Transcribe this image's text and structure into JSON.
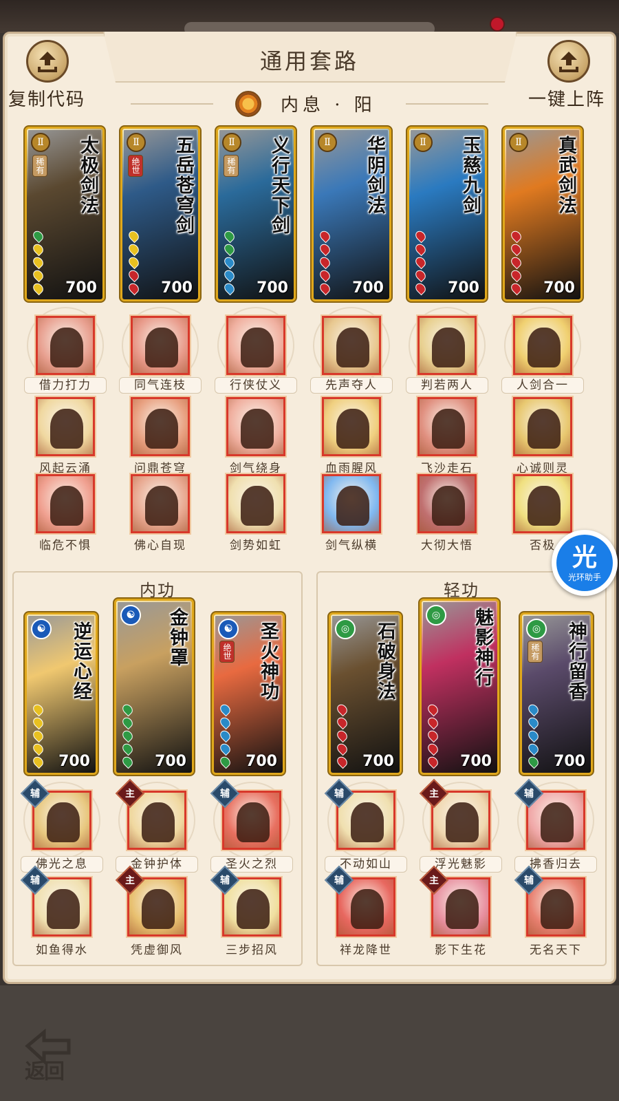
{
  "header": {
    "title": "通用套路",
    "left_label": "复制代码",
    "right_label": "一键上阵",
    "subtitle": "内息 · 阳"
  },
  "top_cards": [
    {
      "name": "太极剑法",
      "tier": "Ⅱ",
      "rarity": "稀有",
      "power": "700",
      "color": "#5a4830",
      "pips": [
        "#2e9a44",
        "#e8c020",
        "#e8c020",
        "#e8c020",
        "#e8c020"
      ]
    },
    {
      "name": "五岳苍穹剑",
      "tier": "Ⅱ",
      "rarity": "绝世",
      "power": "700",
      "color": "#2e5a88",
      "pips": [
        "#e8c020",
        "#e8c020",
        "#e8c020",
        "#c8262a",
        "#c8262a"
      ]
    },
    {
      "name": "义行天下剑",
      "tier": "Ⅱ",
      "rarity": "稀有",
      "power": "700",
      "color": "#2a6a9a",
      "pips": [
        "#2e9a44",
        "#2e9a44",
        "#2a8ac8",
        "#2a8ac8",
        "#2a8ac8"
      ]
    },
    {
      "name": "华阴剑法",
      "tier": "Ⅱ",
      "rarity": "",
      "power": "700",
      "color": "#3a78b8",
      "pips": [
        "#c8262a",
        "#c8262a",
        "#c8262a",
        "#c8262a",
        "#c8262a"
      ]
    },
    {
      "name": "玉慈九剑",
      "tier": "Ⅱ",
      "rarity": "",
      "power": "700",
      "color": "#2a7ac0",
      "pips": [
        "#c8262a",
        "#c8262a",
        "#c8262a",
        "#c8262a",
        "#c8262a"
      ]
    },
    {
      "name": "真武剑法",
      "tier": "Ⅱ",
      "rarity": "",
      "power": "700",
      "color": "#e07a20",
      "pips": [
        "#c8262a",
        "#c8262a",
        "#c8262a",
        "#c8262a",
        "#c8262a"
      ]
    }
  ],
  "skills_row1": [
    {
      "label": "借力打力",
      "color": "#e8a090"
    },
    {
      "label": "同气连枝",
      "color": "#e89a8a"
    },
    {
      "label": "行侠仗义",
      "color": "#f0b0a0"
    },
    {
      "label": "先声夺人",
      "color": "#e8c890"
    },
    {
      "label": "判若两人",
      "color": "#e8d090"
    },
    {
      "label": "人剑合一",
      "color": "#f0d070"
    }
  ],
  "skills_row2": [
    {
      "label": "风起云涌",
      "color": "#f0d8a0"
    },
    {
      "label": "问鼎苍穹",
      "color": "#e8a080"
    },
    {
      "label": "剑气绕身",
      "color": "#f0b0a0"
    },
    {
      "label": "血雨腥风",
      "color": "#f0d080"
    },
    {
      "label": "飞沙走石",
      "color": "#e09080"
    },
    {
      "label": "心诚则灵",
      "color": "#e8c870"
    }
  ],
  "skills_row3": [
    {
      "label": "临危不惧",
      "color": "#f0a090"
    },
    {
      "label": "佛心自现",
      "color": "#e8a890"
    },
    {
      "label": "剑势如虹",
      "color": "#f0e0b0"
    },
    {
      "label": "剑气纵横",
      "color": "#80b8f0"
    },
    {
      "label": "大彻大悟",
      "color": "#c07070"
    },
    {
      "label": "否极",
      "color": "#f0e080"
    }
  ],
  "neigong": {
    "title": "内功",
    "cards": [
      {
        "name": "逆运心经",
        "rarity": "",
        "power": "700",
        "color": "#f0c870",
        "pips": [
          "#e8c020",
          "#e8c020",
          "#e8c020",
          "#e8c020",
          "#e8c020"
        ]
      },
      {
        "name": "金钟罩",
        "rarity": "",
        "power": "700",
        "color": "#c8a060",
        "pips": [
          "#2e9a44",
          "#2e9a44",
          "#2e9a44",
          "#2e9a44",
          "#2e9a44"
        ]
      },
      {
        "name": "圣火神功",
        "rarity": "绝世",
        "power": "700",
        "color": "#e86a40",
        "pips": [
          "#2a8ac8",
          "#2a8ac8",
          "#2a8ac8",
          "#2a8ac8",
          "#2e9a44"
        ]
      }
    ],
    "skills1": [
      {
        "label": "佛光之息",
        "tag": "辅",
        "color": "#e8c880"
      },
      {
        "label": "金钟护体",
        "tag": "主",
        "color": "#f0d8a0"
      },
      {
        "label": "圣火之烈",
        "tag": "辅",
        "color": "#e87060"
      }
    ],
    "skills2": [
      {
        "label": "如鱼得水",
        "tag": "辅",
        "color": "#f0e0b0"
      },
      {
        "label": "凭虚御风",
        "tag": "主",
        "color": "#e8c070"
      },
      {
        "label": "三步招风",
        "tag": "辅",
        "color": "#f0e0a0"
      }
    ]
  },
  "qinggong": {
    "title": "轻功",
    "cards": [
      {
        "name": "石破身法",
        "rarity": "",
        "power": "700",
        "color": "#6a5030",
        "pips": [
          "#c8262a",
          "#c8262a",
          "#c8262a",
          "#c8262a",
          "#c8262a"
        ]
      },
      {
        "name": "魅影神行",
        "rarity": "",
        "power": "700",
        "color": "#c03060",
        "pips": [
          "#c8262a",
          "#c8262a",
          "#c8262a",
          "#c8262a",
          "#c8262a"
        ]
      },
      {
        "name": "神行留香",
        "rarity": "稀有",
        "power": "700",
        "color": "#5a4a6a",
        "pips": [
          "#2a8ac8",
          "#2a8ac8",
          "#2a8ac8",
          "#2a8ac8",
          "#2e9a44"
        ]
      }
    ],
    "skills1": [
      {
        "label": "不动如山",
        "tag": "辅",
        "color": "#f0e0b0"
      },
      {
        "label": "浮光魅影",
        "tag": "主",
        "color": "#f0d8b0"
      },
      {
        "label": "拂香归去",
        "tag": "辅",
        "color": "#f0a8a8"
      }
    ],
    "skills2": [
      {
        "label": "祥龙降世",
        "tag": "辅",
        "color": "#e86860"
      },
      {
        "label": "影下生花",
        "tag": "主",
        "color": "#e890a0"
      },
      {
        "label": "无名天下",
        "tag": "辅",
        "color": "#e88070"
      }
    ]
  },
  "helper": {
    "glyph": "光",
    "label": "光环助手"
  },
  "back_label": "返回"
}
